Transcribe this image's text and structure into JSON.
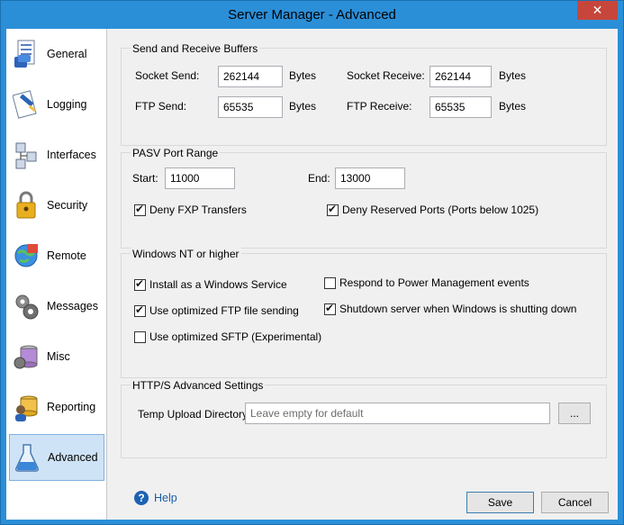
{
  "window": {
    "title": "Server Manager - Advanced",
    "close_glyph": "✕"
  },
  "sidebar": {
    "items": [
      {
        "label": "General",
        "icon": "general-icon"
      },
      {
        "label": "Logging",
        "icon": "logging-icon"
      },
      {
        "label": "Interfaces",
        "icon": "interfaces-icon"
      },
      {
        "label": "Security",
        "icon": "security-icon"
      },
      {
        "label": "Remote",
        "icon": "remote-icon"
      },
      {
        "label": "Messages",
        "icon": "messages-icon"
      },
      {
        "label": "Misc",
        "icon": "misc-icon"
      },
      {
        "label": "Reporting",
        "icon": "reporting-icon"
      },
      {
        "label": "Advanced",
        "icon": "advanced-icon",
        "active": true
      }
    ]
  },
  "buffers": {
    "title": "Send and Receive Buffers",
    "socket_send_label": "Socket Send:",
    "socket_send_value": "262144",
    "socket_receive_label": "Socket Receive:",
    "socket_receive_value": "262144",
    "ftp_send_label": "FTP Send:",
    "ftp_send_value": "65535",
    "ftp_receive_label": "FTP Receive:",
    "ftp_receive_value": "65535",
    "unit": "Bytes"
  },
  "pasv": {
    "title": "PASV Port Range",
    "start_label": "Start:",
    "start_value": "11000",
    "end_label": "End:",
    "end_value": "13000",
    "deny_fxp": {
      "label": "Deny FXP Transfers",
      "checked": true
    },
    "deny_reserved": {
      "label": "Deny Reserved Ports (Ports below 1025)",
      "checked": true
    }
  },
  "windows": {
    "title": "Windows NT or higher",
    "install_service": {
      "label": "Install as a Windows Service",
      "checked": true
    },
    "optimized_ftp": {
      "label": "Use optimized FTP file sending",
      "checked": true
    },
    "optimized_sftp": {
      "label": "Use optimized SFTP (Experimental)",
      "checked": false
    },
    "power_mgmt": {
      "label": "Respond to Power Management events",
      "checked": false
    },
    "shutdown": {
      "label": "Shutdown server when Windows is shutting down",
      "checked": true
    }
  },
  "https": {
    "title": "HTTP/S Advanced Settings",
    "upload_dir_label": "Temp Upload Directory:",
    "upload_dir_placeholder": "Leave empty for default",
    "browse_label": "..."
  },
  "footer": {
    "help_label": "Help",
    "help_glyph": "?",
    "save_label": "Save",
    "cancel_label": "Cancel"
  },
  "colors": {
    "title_bar": "#2b8fd8",
    "close_button": "#c7463b",
    "active_item_bg": "#cfe3f7",
    "help_link": "#1b5ea8"
  }
}
